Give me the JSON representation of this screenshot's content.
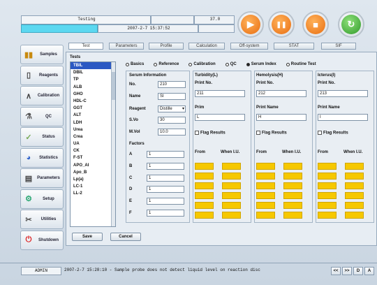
{
  "header": {
    "title": "Testing",
    "counter": "37.0",
    "datetime": "2007-2-7 15:37:52"
  },
  "controls": {
    "play": "▶",
    "pause": "❚❚",
    "stop": "■",
    "refresh": "↻"
  },
  "tabs": [
    "Test",
    "Parameters",
    "Profile",
    "Calculation",
    "Off-system",
    "STAT",
    "SIF"
  ],
  "sidebar": [
    "Samples",
    "Reagents",
    "Calibration",
    "QC",
    "Status",
    "Statistics",
    "Parameters",
    "Setup",
    "Utilities",
    "Shutdown"
  ],
  "tests": {
    "label": "Tests",
    "items": [
      "TBIL",
      "DBIL",
      "TP",
      "ALB",
      "GHO",
      "HDL-C",
      "GGT",
      "ALT",
      "LDH",
      "Urea",
      "Crea",
      "UA",
      "CK",
      "F-ST",
      "APO_AI",
      "Apo_B",
      "Lp(a)",
      "LC-1",
      "LL-2"
    ]
  },
  "options": [
    "Basics",
    "Reference",
    "Calibration",
    "QC",
    "Serum Index",
    "Routine Test"
  ],
  "serum": {
    "title": "Serum Information",
    "no_label": "No.",
    "no": "210",
    "name_label": "Name",
    "name": "SI",
    "reagent_label": "Reagent",
    "reagent": "Distille",
    "sv_label": "S.Vo",
    "sv": "30",
    "mvol_label": "M.Vol",
    "mvol": "10.0"
  },
  "factors": {
    "title": "Factors",
    "labels": [
      "A",
      "B",
      "C",
      "D",
      "E",
      "F"
    ],
    "values": [
      "1",
      "1",
      "1",
      "1",
      "1",
      "1"
    ]
  },
  "index_cols": [
    {
      "title": "Turbidity(L)",
      "print_label": "Print No.",
      "print_no": "211",
      "name_label": "Prim",
      "name": "L",
      "flag": "Flag Results",
      "from": "From",
      "when": "When I.U."
    },
    {
      "title": "Hemolysis(H)",
      "print_label": "Print No.",
      "print_no": "212",
      "name_label": "Print Name",
      "name": "H",
      "flag": "Flag Results",
      "from": "From",
      "when": "When I.U."
    },
    {
      "title": "Icterus(I)",
      "print_label": "Print No.",
      "print_no": "213",
      "name_label": "Print Name",
      "name": "I",
      "flag": "Flag Results",
      "from": "From",
      "when": "When I.U."
    }
  ],
  "buttons": {
    "save": "Save",
    "cancel": "Cancel"
  },
  "status": {
    "user": "ADMIN",
    "message": "2007-2-7 15:28:10 - Sample probe does not detect liquid level on reaction disc",
    "nav": [
      "<<",
      ">>",
      "D",
      "A"
    ]
  }
}
